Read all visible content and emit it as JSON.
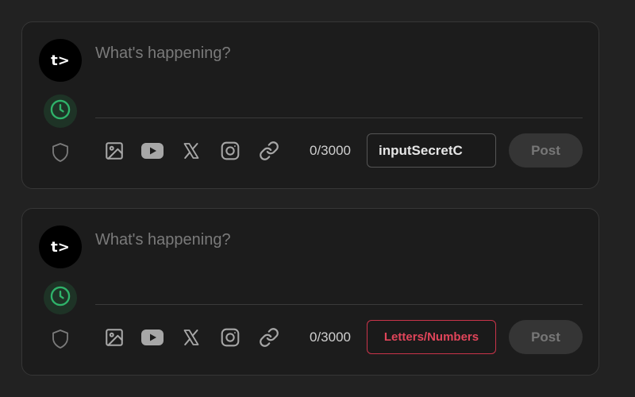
{
  "colors": {
    "page_background": "#222222",
    "card_background": "#1c1c1c",
    "accent_green": "#2fb36a",
    "error_red": "#c9344a"
  },
  "composers": [
    {
      "avatar_text": "t>",
      "compose_placeholder": "What's happening?",
      "counter": "0/3000",
      "secret_value": "inputSecretC",
      "secret_placeholder": "",
      "post_label": "Post",
      "icons": [
        "clock-icon",
        "shield-icon",
        "image-icon",
        "youtube-icon",
        "x-icon",
        "instagram-icon",
        "link-icon"
      ]
    },
    {
      "avatar_text": "t>",
      "compose_placeholder": "What's happening?",
      "counter": "0/3000",
      "secret_value": "",
      "secret_placeholder": "Letters/Numbers",
      "post_label": "Post",
      "icons": [
        "clock-icon",
        "shield-icon",
        "image-icon",
        "youtube-icon",
        "x-icon",
        "instagram-icon",
        "link-icon"
      ]
    }
  ]
}
